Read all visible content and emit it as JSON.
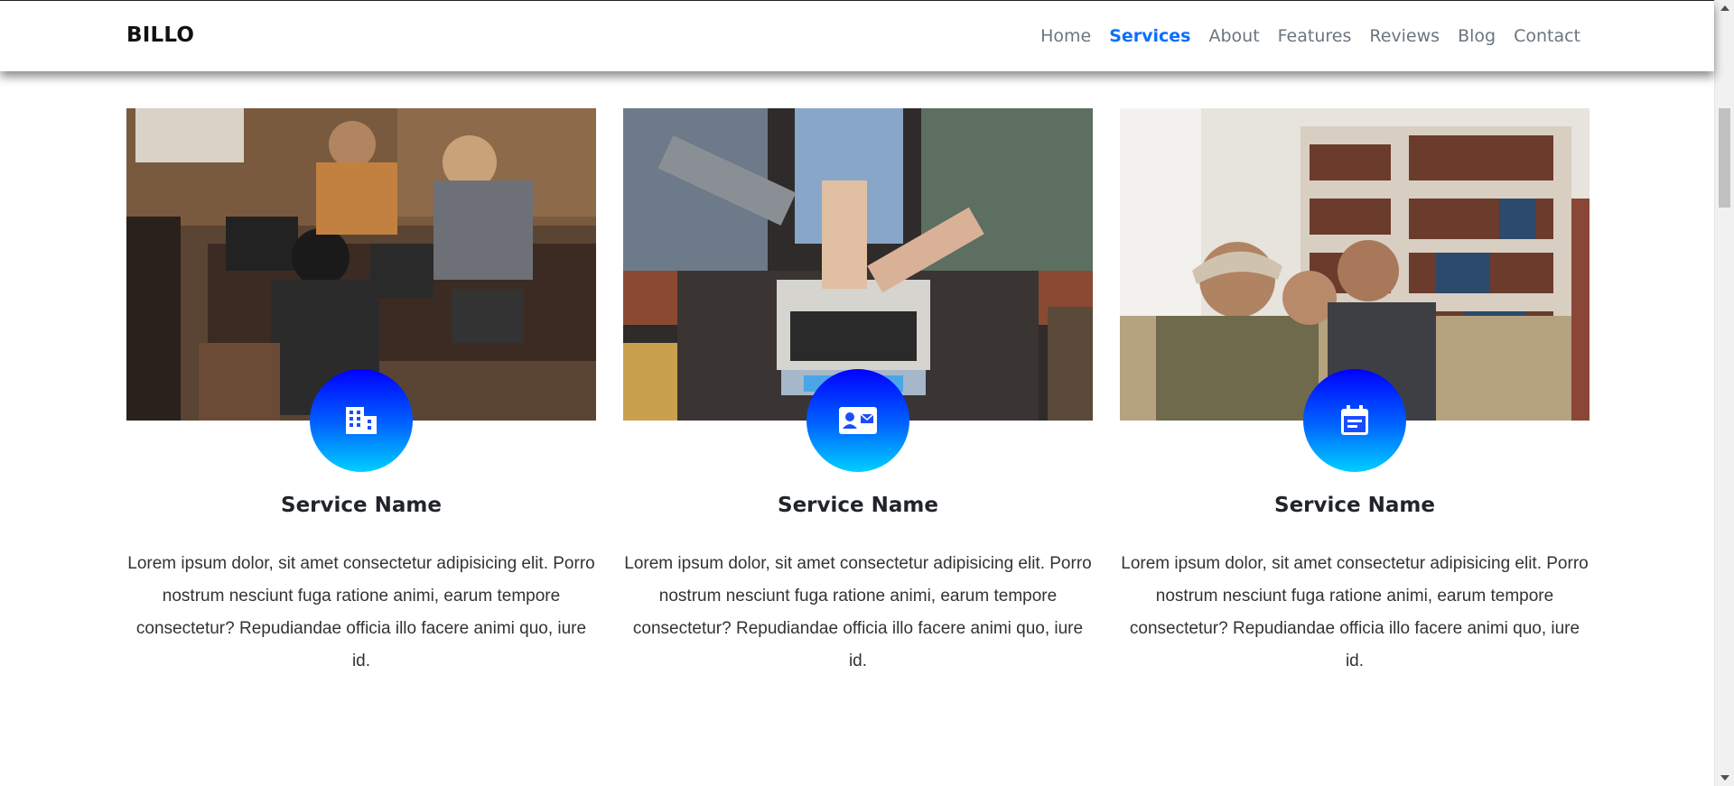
{
  "navbar": {
    "brand": "BILLO",
    "links": [
      {
        "label": "Home",
        "active": false
      },
      {
        "label": "Services",
        "active": true
      },
      {
        "label": "About",
        "active": false
      },
      {
        "label": "Features",
        "active": false
      },
      {
        "label": "Reviews",
        "active": false
      },
      {
        "label": "Blog",
        "active": false
      },
      {
        "label": "Contact",
        "active": false
      }
    ]
  },
  "colors": {
    "accent": "#0d6efd",
    "badge_gradient_top": "#0000ff",
    "badge_gradient_bottom": "#00d0ff"
  },
  "services": [
    {
      "icon": "building-icon",
      "title": "Service Name",
      "text": "Lorem ipsum dolor, sit amet consectetur adipisicing elit. Porro nostrum nesciunt fuga ratione animi, earum tempore consectetur? Repudiandae officia illo facere animi quo, iure id."
    },
    {
      "icon": "contact-card-icon",
      "title": "Service Name",
      "text": "Lorem ipsum dolor, sit amet consectetur adipisicing elit. Porro nostrum nesciunt fuga ratione animi, earum tempore consectetur? Repudiandae officia illo facere animi quo, iure id."
    },
    {
      "icon": "calendar-icon",
      "title": "Service Name",
      "text": "Lorem ipsum dolor, sit amet consectetur adipisicing elit. Porro nostrum nesciunt fuga ratione animi, earum tempore consectetur? Repudiandae officia illo facere animi quo, iure id."
    }
  ]
}
